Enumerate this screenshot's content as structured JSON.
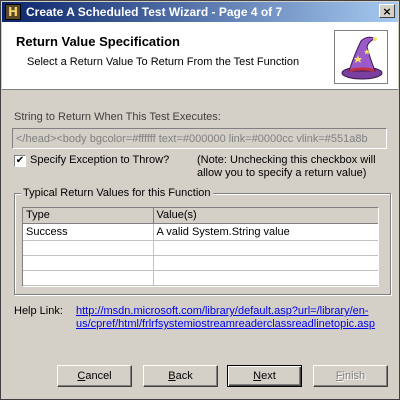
{
  "window": {
    "title": "Create A Scheduled Test Wizard - Page 4 of 7",
    "app_icon_glyph": "H",
    "close_glyph": "×"
  },
  "header": {
    "title": "Return Value Specification",
    "subtitle": "Select a Return Value To Return From the Test Function",
    "image_icon": "wizard-hat-icon"
  },
  "return_string": {
    "label": "String to Return When This Test Executes:",
    "value": "</head><body bgcolor=#ffffff text=#000000 link=#0000cc vlink=#551a8b"
  },
  "exception": {
    "checked_glyph": "✔",
    "label": "Specify Exception to Throw?",
    "note_line1": "(Note: Unchecking this checkbox will",
    "note_line2": "allow you to specify a return value)"
  },
  "typical_values": {
    "legend": "Typical Return Values for this Function",
    "columns": [
      "Type",
      "Value(s)"
    ],
    "rows": [
      [
        "Success",
        "A valid System.String value"
      ],
      [
        "",
        ""
      ],
      [
        "",
        ""
      ],
      [
        "",
        ""
      ]
    ]
  },
  "help": {
    "label": "Help Link:",
    "url_line1": "http://msdn.microsoft.com/library/default.asp?url=/library/en-",
    "url_line2": "us/cpref/html/frlrfsystemiostreamreaderclassreadlinetopic.asp"
  },
  "buttons": {
    "cancel_u": "C",
    "cancel_rest": "ancel",
    "back_u": "B",
    "back_rest": "ack",
    "next_u": "N",
    "next_rest": "ext",
    "finish_u": "F",
    "finish_rest": "inish"
  },
  "colors": {
    "titlebar_start": "#0a246a",
    "titlebar_end": "#a6caf0",
    "link": "#0000ee",
    "face": "#d4d0c8"
  }
}
